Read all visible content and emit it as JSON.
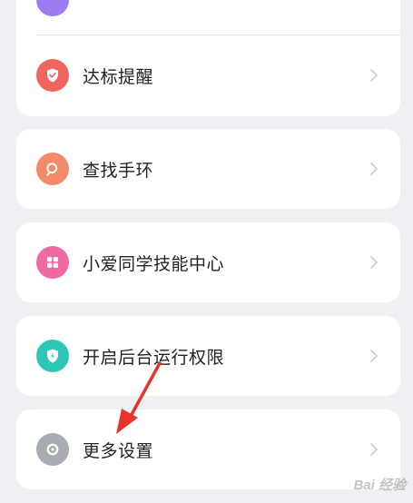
{
  "colors": {
    "background": "#eef0f3",
    "card": "#ffffff",
    "text": "#222222",
    "chevron": "#cfcfcf",
    "annotation_arrow": "#e8332a"
  },
  "items": [
    {
      "label": "达标提醒",
      "icon": "shield-check-icon",
      "color": "#f0645f"
    },
    {
      "label": "查找手环",
      "icon": "search-icon",
      "color": "#f5896b"
    },
    {
      "label": "小爱同学技能中心",
      "icon": "apps-grid-icon",
      "color": "#ee6aa0"
    },
    {
      "label": "开启后台运行权限",
      "icon": "shield-bolt-icon",
      "color": "#2dc6b8"
    },
    {
      "label": "更多设置",
      "icon": "gear-icon",
      "color": "#a7abb2"
    }
  ],
  "watermark": "Bai 经验"
}
